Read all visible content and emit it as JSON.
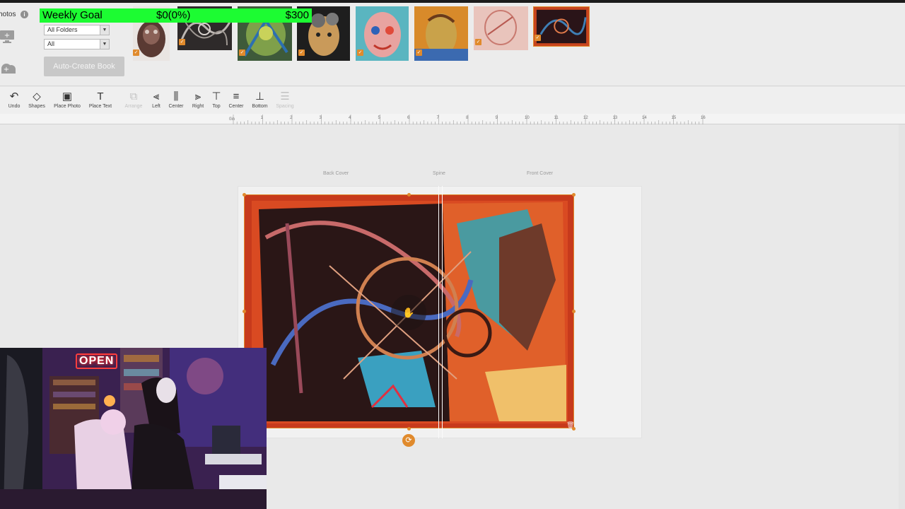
{
  "photos_panel": {
    "label": "hotos",
    "folder_filter": "All Folders",
    "type_filter": "All",
    "auto_create_label": "Auto-Create Book"
  },
  "weekly_goal": {
    "label": "Weekly Goal",
    "current": "$0(0%)",
    "target": "$300",
    "progress": 0
  },
  "toolbar": {
    "undo": "Undo",
    "shapes": "Shapes",
    "place_photo": "Place Photo",
    "place_text": "Place Text",
    "arrange": "Arrange",
    "left": "Left",
    "center": "Center",
    "right": "Right",
    "top": "Top",
    "center_v": "Center",
    "bottom": "Bottom",
    "spacing": "Spacing"
  },
  "ruler": {
    "origin": "0in",
    "ticks": [
      "1",
      "2",
      "3",
      "4",
      "5",
      "6",
      "7",
      "8",
      "9",
      "10",
      "11",
      "12",
      "13",
      "14",
      "15",
      "16"
    ]
  },
  "cover_labels": {
    "back": "Back Cover",
    "spine": "Spine",
    "front": "Front Cover"
  },
  "webcam": {
    "sign": "OPEN"
  },
  "colors": {
    "accent": "#e08a2c",
    "goal_bar": "#1cfc32",
    "canvas_bg": "#e9e9e9"
  }
}
